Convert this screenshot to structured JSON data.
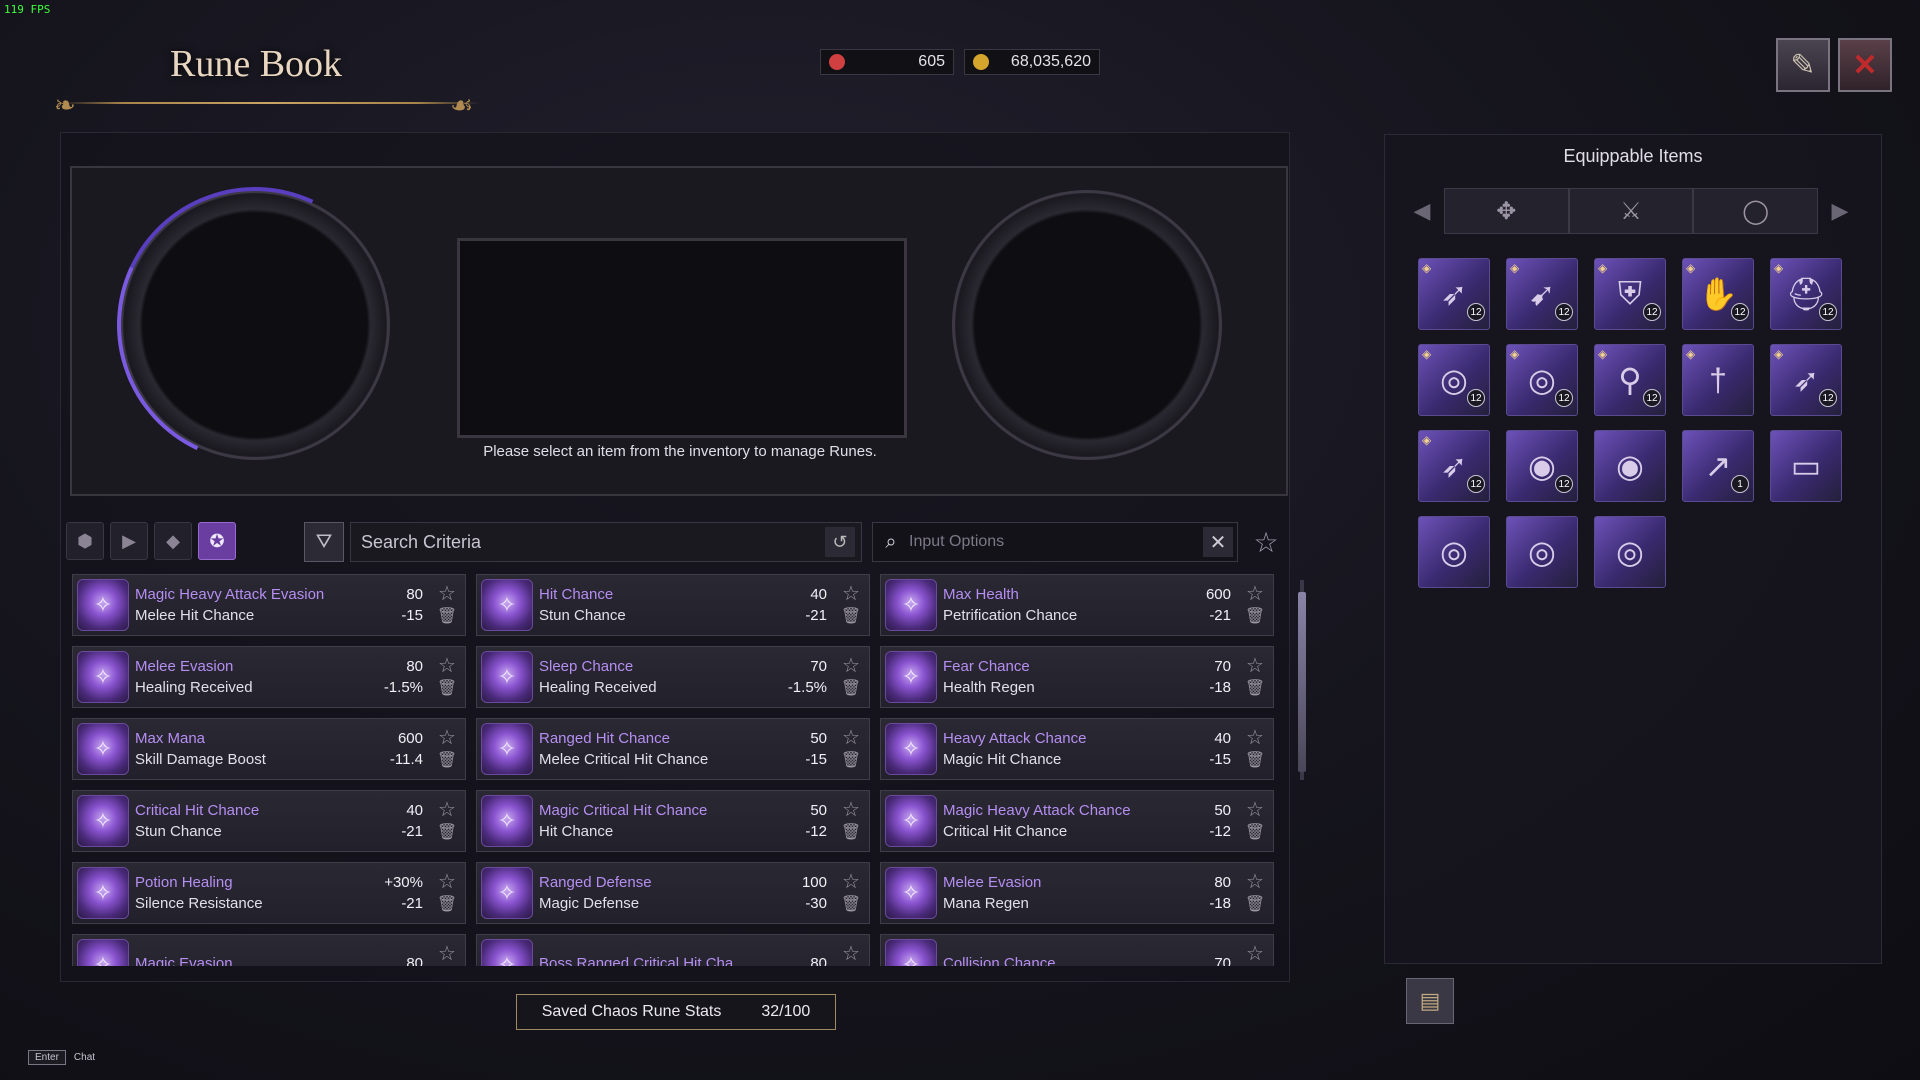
{
  "fps": "119 FPS",
  "title": "Rune Book",
  "currency": [
    {
      "name": "rune-shard",
      "value": "605",
      "color": "#d04040"
    },
    {
      "name": "gold",
      "value": "68,035,620",
      "color": "#d4a52c"
    }
  ],
  "display": {
    "message": "Please select an item from the inventory to manage Runes."
  },
  "filters": {
    "search_label": "Search Criteria",
    "input_placeholder": "Input Options"
  },
  "runes": [
    {
      "name": "Magic Heavy Attack Evasion",
      "value": "80",
      "sub": "Melee Hit Chance",
      "sub_value": "-15"
    },
    {
      "name": "Hit Chance",
      "value": "40",
      "sub": "Stun Chance",
      "sub_value": "-21"
    },
    {
      "name": "Max Health",
      "value": "600",
      "sub": "Petrification Chance",
      "sub_value": "-21"
    },
    {
      "name": "Melee Evasion",
      "value": "80",
      "sub": "Healing Received",
      "sub_value": "-1.5%"
    },
    {
      "name": "Sleep Chance",
      "value": "70",
      "sub": "Healing Received",
      "sub_value": "-1.5%"
    },
    {
      "name": "Fear Chance",
      "value": "70",
      "sub": "Health Regen",
      "sub_value": "-18"
    },
    {
      "name": "Max Mana",
      "value": "600",
      "sub": "Skill Damage Boost",
      "sub_value": "-11.4"
    },
    {
      "name": "Ranged Hit Chance",
      "value": "50",
      "sub": "Melee Critical Hit Chance",
      "sub_value": "-15"
    },
    {
      "name": "Heavy Attack Chance",
      "value": "40",
      "sub": "Magic Hit Chance",
      "sub_value": "-15"
    },
    {
      "name": "Critical Hit Chance",
      "value": "40",
      "sub": "Stun Chance",
      "sub_value": "-21"
    },
    {
      "name": "Magic Critical Hit Chance",
      "value": "50",
      "sub": "Hit Chance",
      "sub_value": "-12"
    },
    {
      "name": "Magic Heavy Attack Chance",
      "value": "50",
      "sub": "Critical Hit Chance",
      "sub_value": "-12"
    },
    {
      "name": "Potion Healing",
      "value": "+30%",
      "sub": "Silence Resistance",
      "sub_value": "-21"
    },
    {
      "name": "Ranged Defense",
      "value": "100",
      "sub": "Magic Defense",
      "sub_value": "-30"
    },
    {
      "name": "Melee Evasion",
      "value": "80",
      "sub": "Mana Regen",
      "sub_value": "-18"
    },
    {
      "name": "Magic Evasion",
      "value": "80",
      "sub": "",
      "sub_value": ""
    },
    {
      "name": "Boss Ranged Critical Hit Cha",
      "value": "80",
      "sub": "",
      "sub_value": ""
    },
    {
      "name": "Collision Chance",
      "value": "70",
      "sub": "",
      "sub_value": ""
    }
  ],
  "saved": {
    "label": "Saved Chaos Rune Stats",
    "count": "32/100"
  },
  "equippable": {
    "title": "Equippable Items",
    "items": [
      {
        "icon": "crossbow-icon",
        "level": "12"
      },
      {
        "icon": "bow-icon",
        "level": "12"
      },
      {
        "icon": "armor-icon",
        "level": "12"
      },
      {
        "icon": "gloves-icon",
        "level": "12"
      },
      {
        "icon": "helmet-icon",
        "level": "12"
      },
      {
        "icon": "ring-icon",
        "level": "12"
      },
      {
        "icon": "ring-icon",
        "level": "12"
      },
      {
        "icon": "earring-icon",
        "level": "12"
      },
      {
        "icon": "dagger-icon",
        "level": ""
      },
      {
        "icon": "crossbow-icon",
        "level": "12"
      },
      {
        "icon": "crossbow-icon",
        "level": "12"
      },
      {
        "icon": "bracelet-icon",
        "level": "12"
      },
      {
        "icon": "bracelet-icon",
        "level": ""
      },
      {
        "icon": "spear-icon",
        "level": "1"
      },
      {
        "icon": "belt-icon",
        "level": ""
      },
      {
        "icon": "ring-icon",
        "level": ""
      },
      {
        "icon": "ring-icon",
        "level": ""
      },
      {
        "icon": "ring-icon",
        "level": ""
      }
    ]
  },
  "chat": {
    "key": "Enter",
    "label": "Chat"
  }
}
